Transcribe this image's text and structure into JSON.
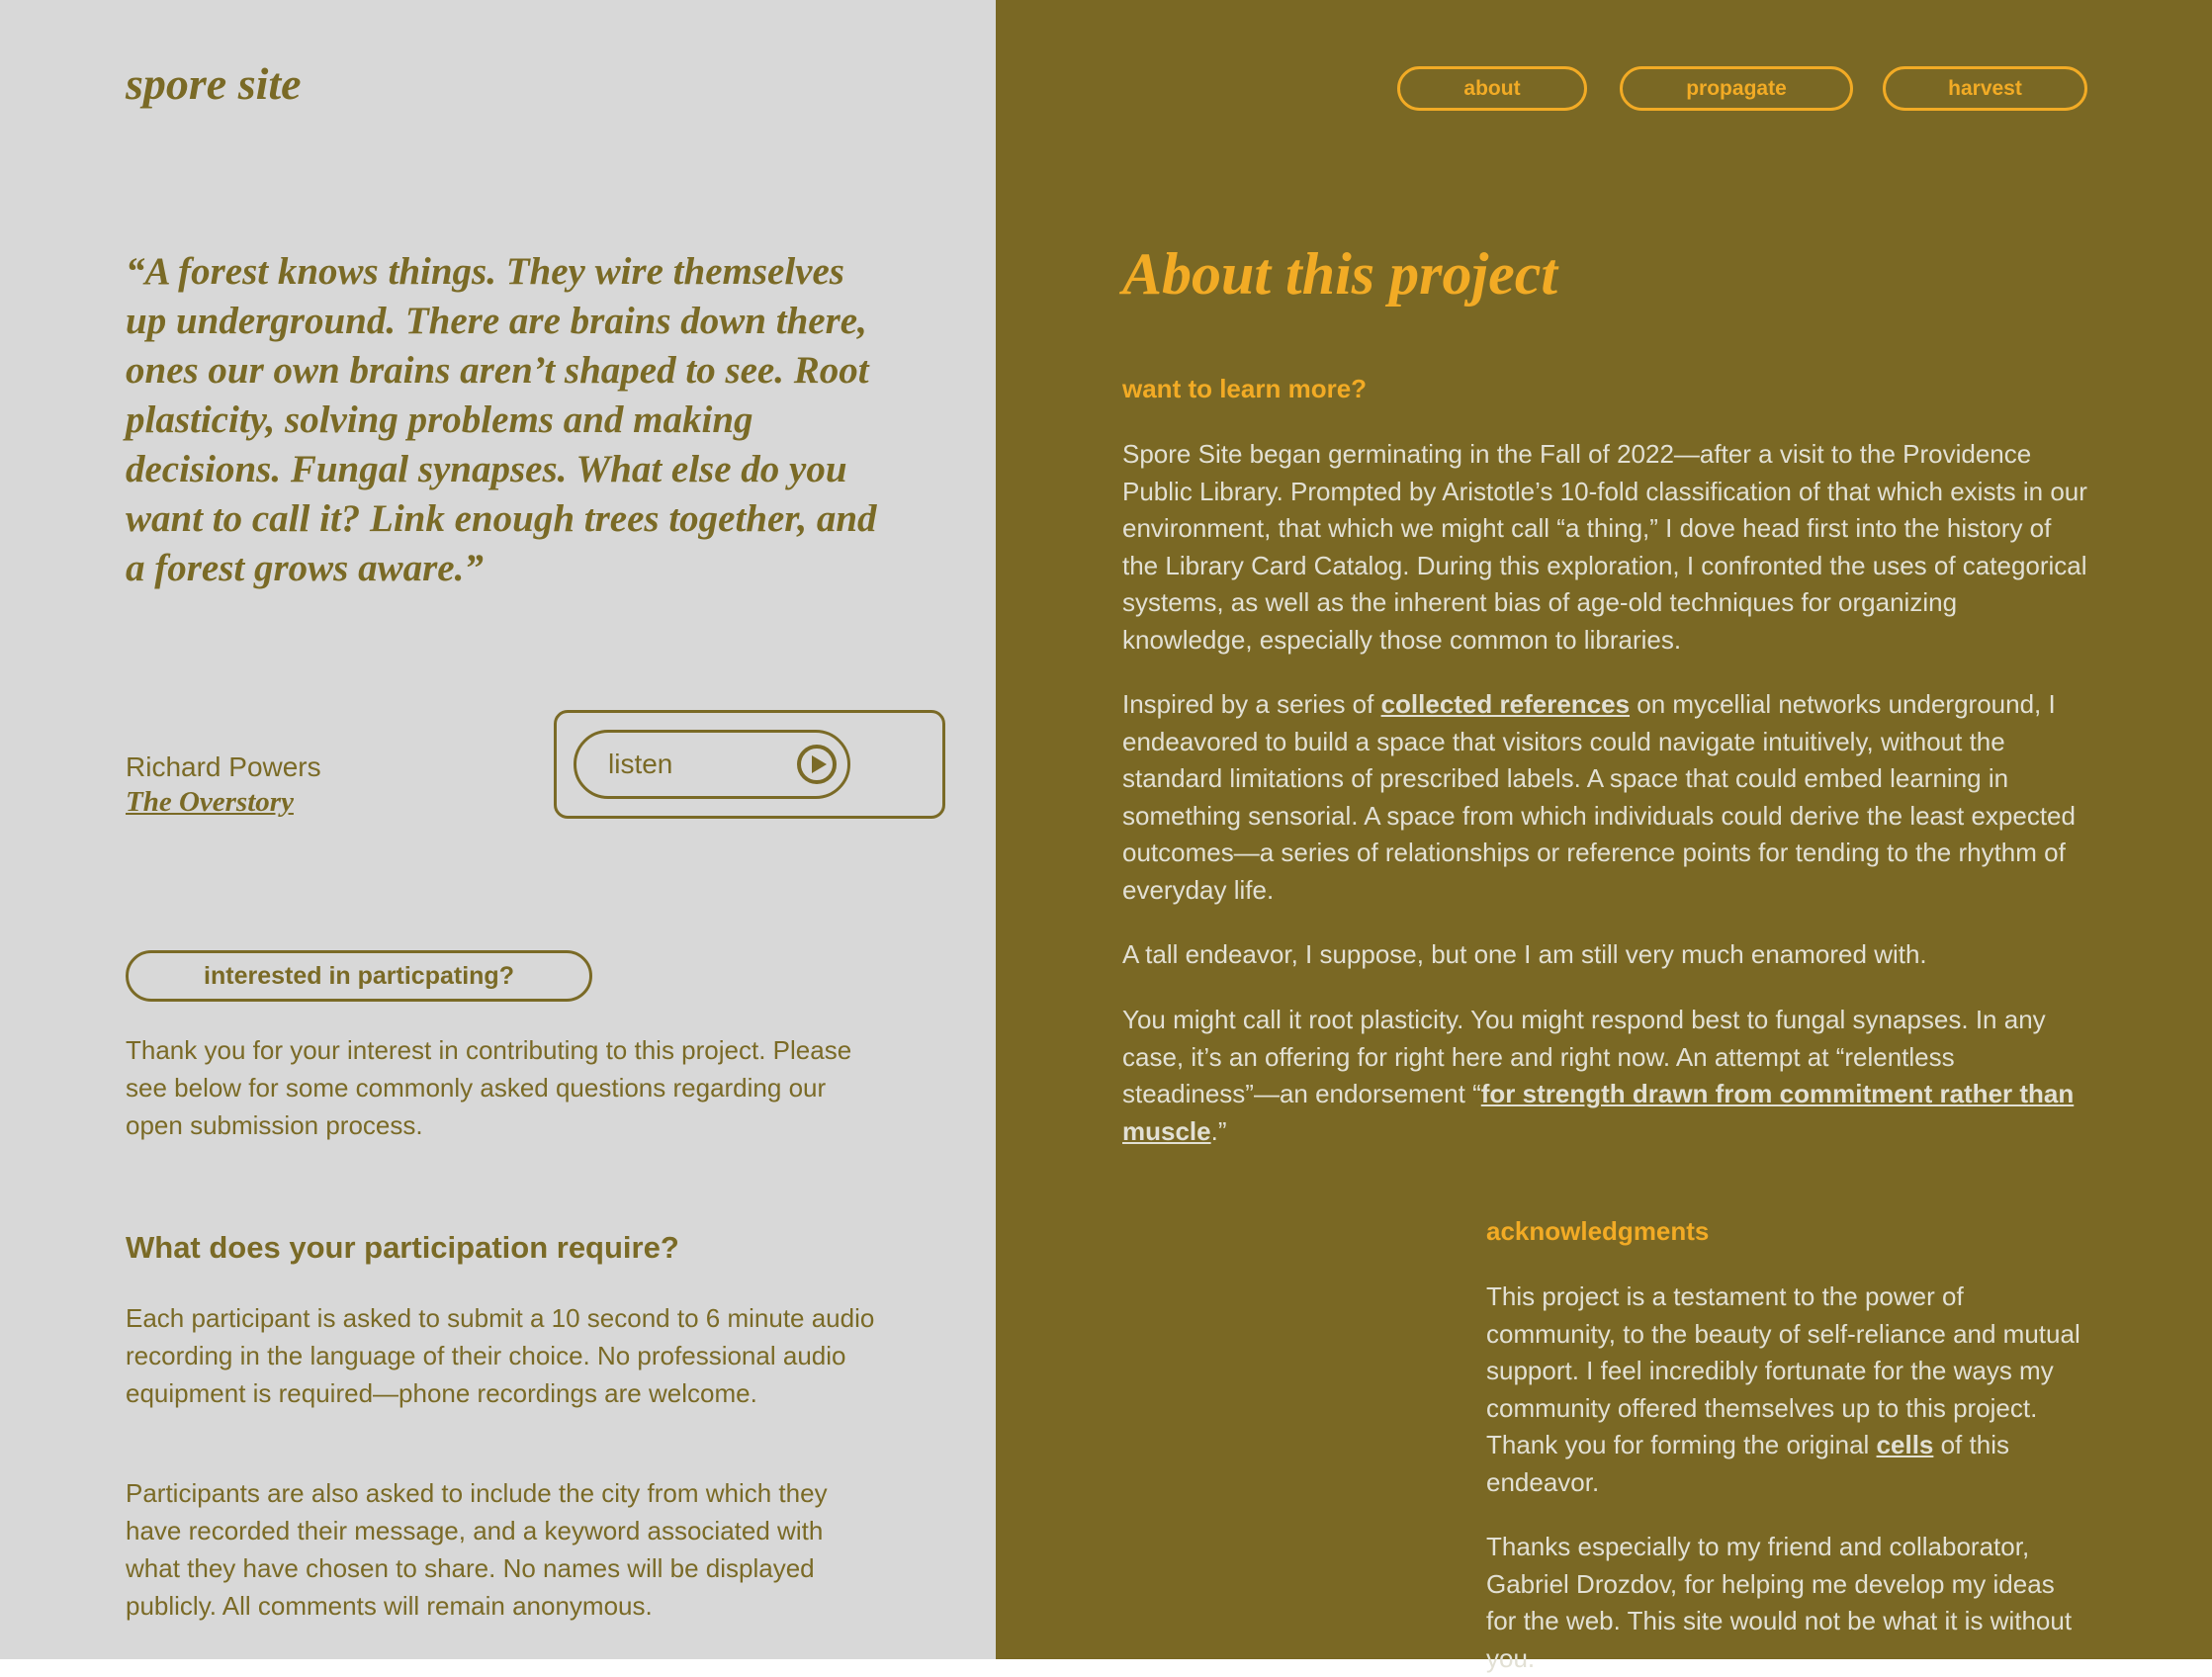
{
  "site": {
    "logo": "spore site"
  },
  "nav": [
    {
      "label": "about"
    },
    {
      "label": "propagate"
    },
    {
      "label": "harvest"
    }
  ],
  "quote": {
    "text": "“A forest knows things. They wire themselves up underground. There are brains down there, ones our own brains aren’t shaped to see. Root plasticity, solving problems and making decisions. Fungal synapses. What else do you want to call it? Link enough trees together, and a forest grows aware.”",
    "author": "Richard Powers",
    "book": "The Overstory"
  },
  "listen": {
    "label": "listen",
    "icon": "play-icon"
  },
  "participate": {
    "button_label": "interested in particpating?",
    "intro": "Thank you for your interest in contributing to this project. Please see below for some commonly asked questions regarding our open submission process.",
    "faq_heading": "What does your participation require?",
    "faq_p1": "Each participant is asked to submit a 10 second to 6 minute audio recording in the language of their choice. No professional audio equipment is required—phone recordings are welcome.",
    "faq_p2": "Participants are also asked to include the city from which they have recorded their message, and a keyword associated with what they have chosen to share. No names will be displayed publicly. All comments will remain anonymous."
  },
  "about": {
    "title": "About this project",
    "subheading": "want to learn more?",
    "p1": "Spore Site began germinating in the Fall of 2022—after a visit to the Providence Public Library. Prompted by Aristotle’s 10-fold classification of that which exists in our environment, that which we might call “a thing,” I dove head first into the history of the Library Card Catalog. During this exploration, I confronted the uses of categorical systems, as well as the inherent bias of age-old techniques for organizing knowledge, especially those common to libraries.",
    "p2_before": "Inspired by a series of ",
    "p2_link": "collected references",
    "p2_after": " on mycellial networks underground, I endeavored to build a space that visitors could navigate intuitively, without the standard limitations of prescribed labels. A space that could embed learning in something sensorial. A space from which individuals could derive the least expected outcomes—a series of relationships or reference points for tending to the rhythm of everyday life.",
    "p3": "A tall endeavor, I suppose, but one I am still very much enamored with.",
    "p4_before": "You might call it root plasticity. You might respond best to fungal synapses. In any case, it’s an offering for right here and right now. An attempt at “relentless steadiness”—an endorsement “",
    "p4_link": "for strength drawn from commitment rather than muscle",
    "p4_after": ".”"
  },
  "acknowledgments": {
    "heading": "acknowledgments",
    "p1_before": "This project is a testament to the power of community, to the beauty of self-reliance and mutual support. I feel incredibly fortunate for the ways my community offered themselves up to this project. Thank you for forming the original ",
    "p1_link": "cells",
    "p1_after": " of this endeavor.",
    "p2": "Thanks especially to my friend and collaborator, Gabriel Drozdov, for helping me develop my ideas for the web. This site would not be what it is without you."
  },
  "colors": {
    "left_bg": "#d8d8d8",
    "right_bg": "#7a6824",
    "olive_text": "#7a6a26",
    "accent": "#f2ab25",
    "light_text": "#e2e0d4"
  }
}
